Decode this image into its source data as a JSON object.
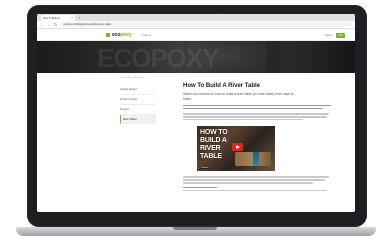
{
  "browser": {
    "tab_title": "How To Build A",
    "url": "ecopoxy.com/blogs/how-to-build-a-river-table",
    "new_tab": "+",
    "tab_close": "×",
    "back": "←",
    "forward": "→",
    "reload": "↻"
  },
  "site": {
    "logo_prefix": "eco",
    "logo_accent": "poxy",
    "nav_link": "Products",
    "right_links": [
      "Sign In",
      "Cart"
    ],
    "hero_watermark": "ECOPOXY"
  },
  "sidebar": {
    "breadcrumb": "Home / Blog / River Table",
    "items": [
      {
        "label": "Getting Started"
      },
      {
        "label": "Product Guides"
      },
      {
        "label": "Projects"
      },
      {
        "label": "River Tables"
      }
    ]
  },
  "article": {
    "title": "How To Build A River Table",
    "subtitle": "Watch our tutorial on how to build a river table (or resin table) from start to finish."
  },
  "video": {
    "line1": "HOW TO",
    "line2": "BUILD A",
    "line3": "RIVER",
    "line4": "TABLE",
    "channel": "ecopoxy"
  },
  "colors": {
    "brand_green": "#7bb32e",
    "laptop_bezel": "#1e1f22",
    "play_red": "#e62117"
  }
}
